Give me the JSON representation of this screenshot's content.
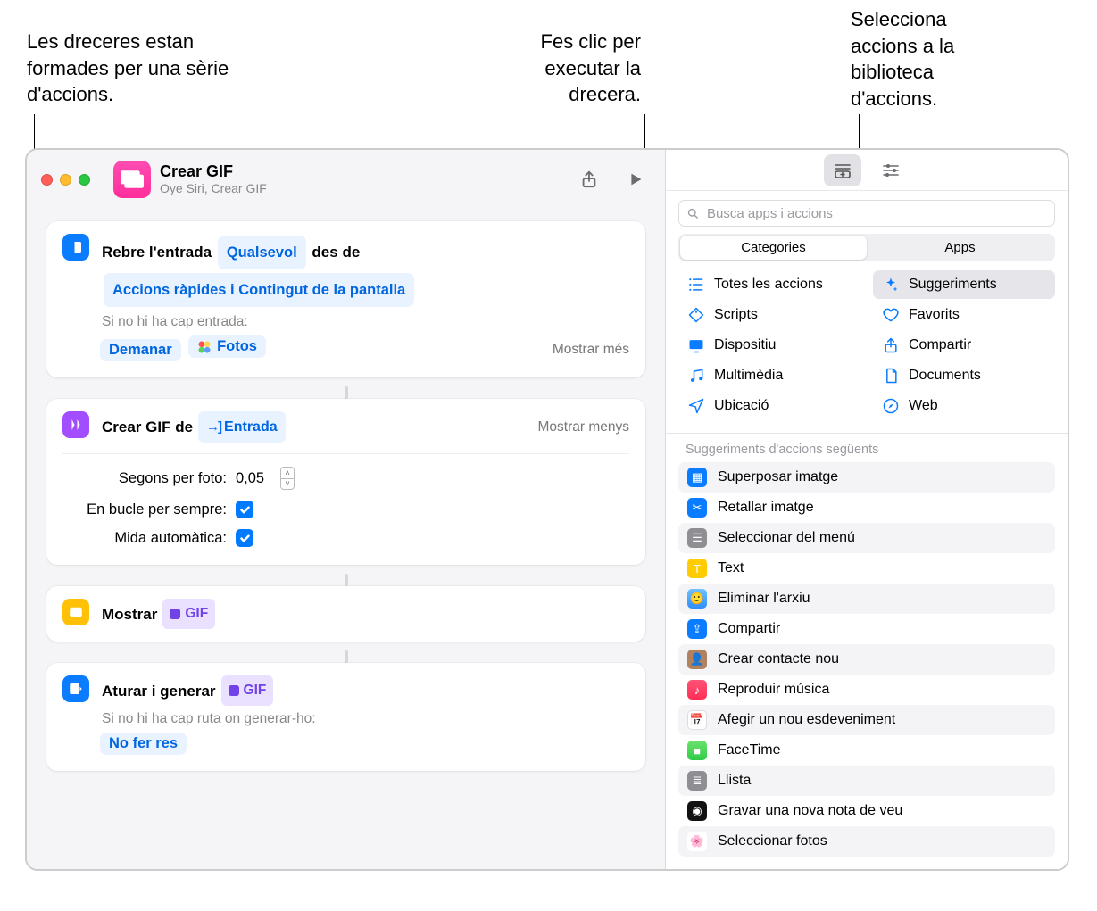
{
  "callouts": {
    "actions_series": "Les dreceres estan formades per una sèrie d'accions.",
    "run": "Fes clic per executar la drecera.",
    "library": "Selecciona accions a la biblioteca d'accions."
  },
  "header": {
    "title": "Crear GIF",
    "subtitle": "Oye Siri, Crear GIF"
  },
  "step_input": {
    "t1": "Rebre l'entrada ",
    "chip_any": "Qualsevol",
    "t2": " des de ",
    "chip_sources": "Accions ràpides i Contingut de la pantalla",
    "no_input_label": "Si no hi ha cap entrada:",
    "chip_ask": "Demanar",
    "chip_photos": "Fotos",
    "show_more": "Mostrar més"
  },
  "step_makegif": {
    "t1": "Crear GIF de ",
    "chip_entrada": "Entrada",
    "show_less": "Mostrar menys",
    "p_seconds": "Segons per foto:",
    "p_seconds_val": "0,05",
    "p_loop": "En bucle per sempre:",
    "p_autosize": "Mida automàtica:"
  },
  "step_show": {
    "t1": "Mostrar ",
    "chip_gif": "GIF"
  },
  "step_output": {
    "t1": "Aturar i generar ",
    "chip_gif": "GIF",
    "no_route": "Si no hi ha cap ruta on generar-ho:",
    "chip_noop": "No fer res"
  },
  "search": {
    "placeholder": "Busca apps i accions"
  },
  "segmented": {
    "categories": "Categories",
    "apps": "Apps"
  },
  "categories": [
    {
      "label": "Totes les accions",
      "icon": "list",
      "color": "#0a7cff"
    },
    {
      "label": "Suggeriments",
      "icon": "sparkle",
      "color": "#0a7cff",
      "selected": true
    },
    {
      "label": "Scripts",
      "icon": "tag",
      "color": "#0a7cff"
    },
    {
      "label": "Favorits",
      "icon": "heart",
      "color": "#0a7cff"
    },
    {
      "label": "Dispositiu",
      "icon": "display",
      "color": "#0a7cff"
    },
    {
      "label": "Compartir",
      "icon": "share",
      "color": "#0a7cff"
    },
    {
      "label": "Multimèdia",
      "icon": "music",
      "color": "#0a7cff"
    },
    {
      "label": "Documents",
      "icon": "doc",
      "color": "#0a7cff"
    },
    {
      "label": "Ubicació",
      "icon": "nav",
      "color": "#0a7cff"
    },
    {
      "label": "Web",
      "icon": "safari",
      "color": "#0a7cff"
    }
  ],
  "suggestions": {
    "header": "Suggeriments d'accions següents",
    "items": [
      {
        "label": "Superposar imatge",
        "bg": "#0a7cff",
        "glyph": "▦"
      },
      {
        "label": "Retallar imatge",
        "bg": "#0a7cff",
        "glyph": "✂"
      },
      {
        "label": "Seleccionar del menú",
        "bg": "#8e8e93",
        "glyph": "☰"
      },
      {
        "label": "Text",
        "bg": "#ffcc00",
        "glyph": "T"
      },
      {
        "label": "Eliminar l'arxiu",
        "bg": "linear-gradient(#6ec2ff,#2e8cff)",
        "glyph": "🙂"
      },
      {
        "label": "Compartir",
        "bg": "#0a7cff",
        "glyph": "⇪"
      },
      {
        "label": "Crear contacte nou",
        "bg": "#b08260",
        "glyph": "👤"
      },
      {
        "label": "Reproduir música",
        "bg": "linear-gradient(#ff5377,#ff2d55)",
        "glyph": "♪"
      },
      {
        "label": "Afegir un nou esdeveniment",
        "bg": "#ffffff",
        "glyph": "📅",
        "fg": "#ff3b30"
      },
      {
        "label": "FaceTime",
        "bg": "linear-gradient(#6de26d,#2ecc46)",
        "glyph": "■"
      },
      {
        "label": "Llista",
        "bg": "#8e8e93",
        "glyph": "≣"
      },
      {
        "label": "Gravar una nova nota de veu",
        "bg": "#111",
        "glyph": "◉"
      },
      {
        "label": "Seleccionar fotos",
        "bg": "radial-gradient(circle,#fff,#fff)",
        "glyph": "🌸"
      }
    ]
  }
}
